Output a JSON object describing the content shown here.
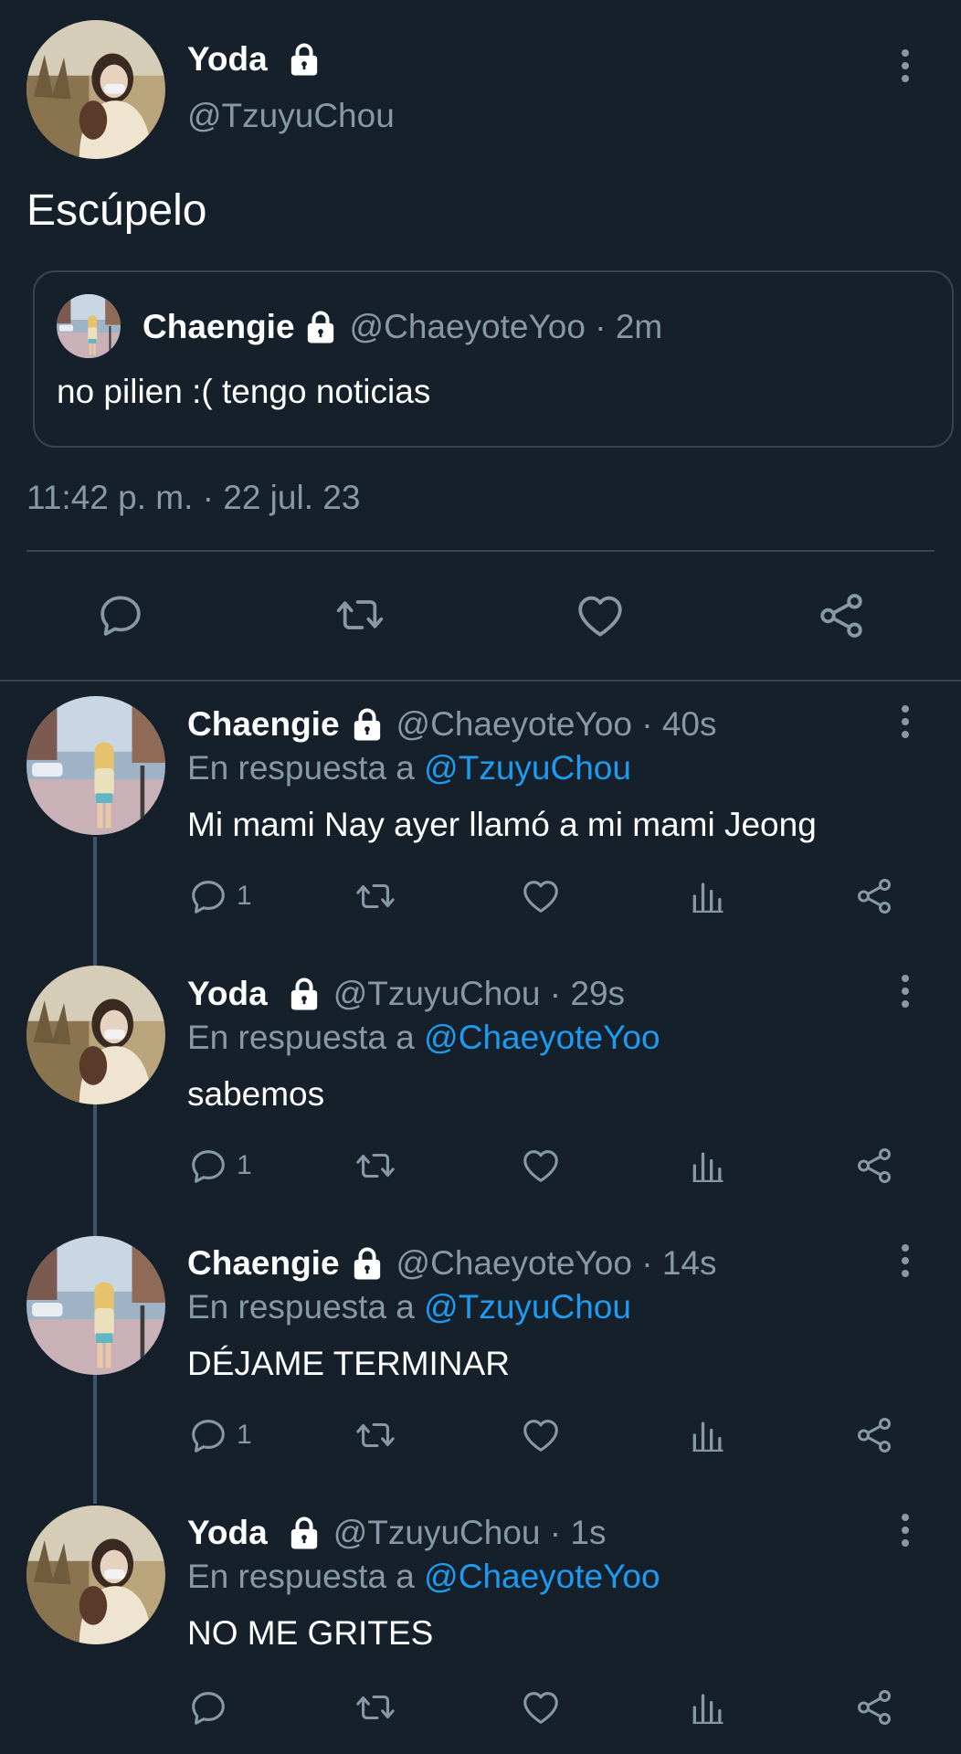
{
  "main_tweet": {
    "author_name": "Yoda",
    "handle": "@TzuyuChou",
    "text": "Escúpelo",
    "timestamp": "11:42 p. m. · 22 jul. 23",
    "quoted": {
      "author_name": "Chaengie",
      "handle_time": "@ChaeyoteYoo · 2m",
      "text": "no pilien :( tengo noticias"
    }
  },
  "icons": {
    "reply": "reply-icon",
    "retweet": "retweet-icon",
    "like": "heart-icon",
    "share": "share-icon",
    "views": "analytics-icon",
    "lock": "lock-icon",
    "more": "more-icon"
  },
  "reply_prefix": "En respuesta a",
  "replies": [
    {
      "author_name": "Chaengie",
      "handle_time": "@ChaeyoteYoo · 40s",
      "reply_to": "@TzuyuChou",
      "text": "Mi mami Nay ayer llamó a mi mami Jeong",
      "reply_count": "1"
    },
    {
      "author_name": "Yoda",
      "handle_time": "@TzuyuChou · 29s",
      "reply_to": "@ChaeyoteYoo",
      "text": "sabemos",
      "reply_count": "1"
    },
    {
      "author_name": "Chaengie",
      "handle_time": "@ChaeyoteYoo · 14s",
      "reply_to": "@TzuyuChou",
      "text": "DÉJAME TERMINAR",
      "reply_count": "1"
    },
    {
      "author_name": "Yoda",
      "handle_time": "@TzuyuChou · 1s",
      "reply_to": "@ChaeyoteYoo",
      "text": "NO ME GRITES",
      "reply_count": ""
    }
  ],
  "colors": {
    "background": "#15202b",
    "muted": "#8899a6",
    "link": "#1d9bf0",
    "divider": "#38444d"
  }
}
